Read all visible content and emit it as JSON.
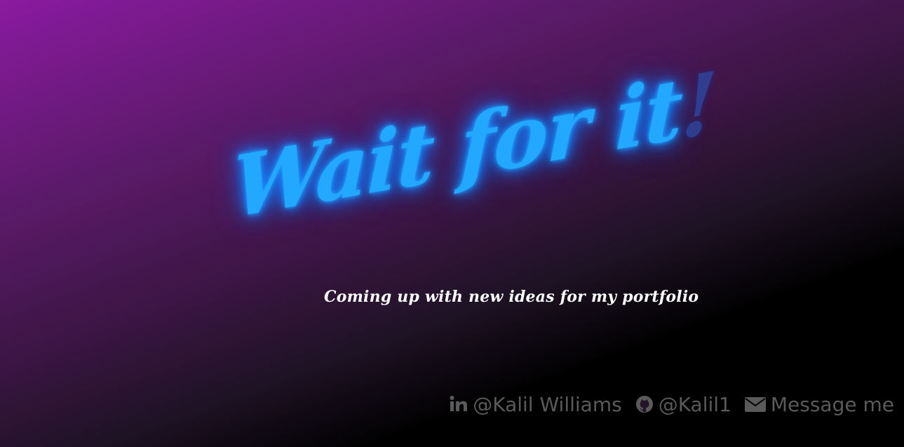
{
  "hero": {
    "title": "Wait for it",
    "title_bang": "!",
    "subtitle": "Coming up with new ideas for my portfolio"
  },
  "contacts": [
    {
      "icon": "linkedin-icon",
      "label": "@Kalil Williams"
    },
    {
      "icon": "github-icon",
      "label": "@Kalil1"
    },
    {
      "icon": "envelope-icon",
      "label": "Message me"
    }
  ],
  "colors": {
    "neon": "#22a8ff",
    "bang": "#2c4aa8",
    "subtitle": "#ffffff",
    "contact": "#5a5a5a",
    "gradient_start": "#8a1aa0",
    "gradient_end": "#000000"
  }
}
